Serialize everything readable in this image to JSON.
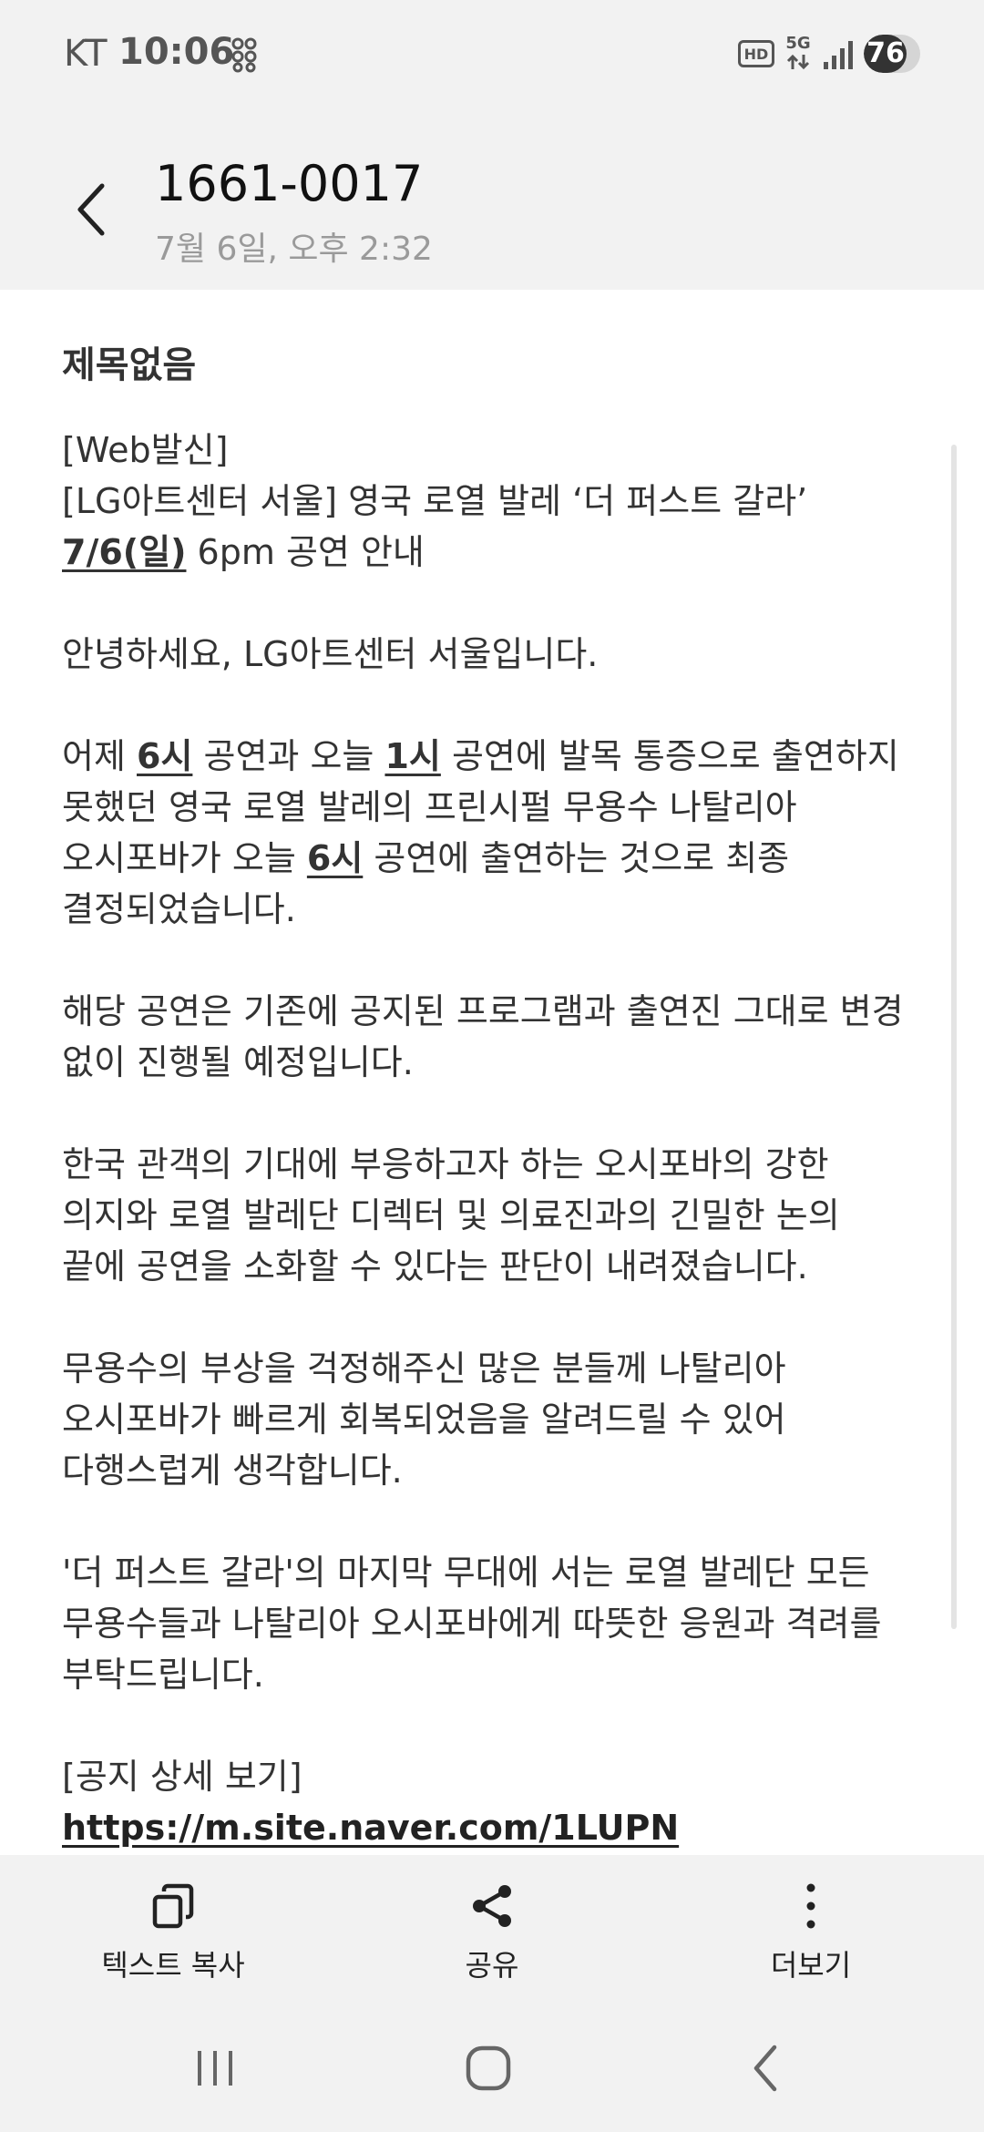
{
  "status_bar": {
    "carrier": "KT",
    "time": "10:06",
    "hd_badge": "HD",
    "network": "5G",
    "battery_percent": 76,
    "battery_text": "76"
  },
  "header": {
    "sender": "1661-0017",
    "timestamp": "7월 6일, 오후 2:32"
  },
  "message": {
    "subject": "제목없음",
    "lines": {
      "l1": "[Web발신]",
      "l2": "[LG아트센터 서울] 영국 로열 발레 ‘더 퍼스트 갈라’",
      "l3_hl": "7/6(일)",
      "l3_rest": " 6pm 공연 안내",
      "l4": "안녕하세요, LG아트센터 서울입니다.",
      "l5_a": "어제 ",
      "l5_hl1": "6시",
      "l5_b": " 공연과 오늘 ",
      "l5_hl2": "1시",
      "l5_c": " 공연에 발목 통증으로 출연하지",
      "l6": "못했던 영국 로열 발레의 프린시펄 무용수 나탈리아",
      "l7_a": "오시포바가 오늘 ",
      "l7_hl": "6시",
      "l7_b": " 공연에 출연하는 것으로 최종",
      "l8": "결정되었습니다.",
      "l9": "해당 공연은 기존에 공지된 프로그램과 출연진 그대로 변경",
      "l10": "없이 진행될 예정입니다.",
      "l11": "한국 관객의 기대에 부응하고자 하는 오시포바의 강한",
      "l12": "의지와 로열 발레단 디렉터 및 의료진과의 긴밀한 논의",
      "l13": "끝에 공연을 소화할 수 있다는 판단이 내려졌습니다.",
      "l14": "무용수의 부상을 걱정해주신 많은 분들께 나탈리아",
      "l15": "오시포바가 빠르게 회복되었음을 알려드릴 수 있어",
      "l16": "다행스럽게 생각합니다.",
      "l17": "'더 퍼스트 갈라'의 마지막 무대에 서는 로열 발레단 모든",
      "l18": "무용수들과 나탈리아 오시포바에게 따뜻한 응원과 격려를",
      "l19": "부탁드립니다.",
      "l20": "[공지 상세 보기]",
      "link": "https://m.site.naver.com/1LUPN"
    }
  },
  "actions": {
    "copy": "텍스트 복사",
    "share": "공유",
    "more": "더보기"
  },
  "icons": {
    "back": "chevron-left-icon",
    "copy": "copy-icon",
    "share": "share-icon",
    "more": "more-vertical-icon"
  }
}
